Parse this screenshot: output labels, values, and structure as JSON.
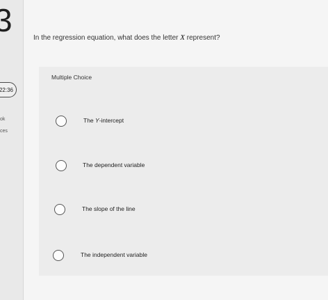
{
  "sidebar": {
    "question_number": "3",
    "timer": "22:36",
    "partial_text_1": "ok",
    "partial_text_2": "ces"
  },
  "question": {
    "text_before": "In the regression equation, what does the letter ",
    "variable": "X",
    "text_after": " represent?"
  },
  "multiple_choice": {
    "label": "Multiple Choice",
    "options": [
      {
        "prefix": "The ",
        "variable": "Y",
        "suffix": "-intercept"
      },
      {
        "text": "The dependent variable"
      },
      {
        "text": "The slope of the line"
      },
      {
        "text": "The independent variable"
      }
    ]
  }
}
